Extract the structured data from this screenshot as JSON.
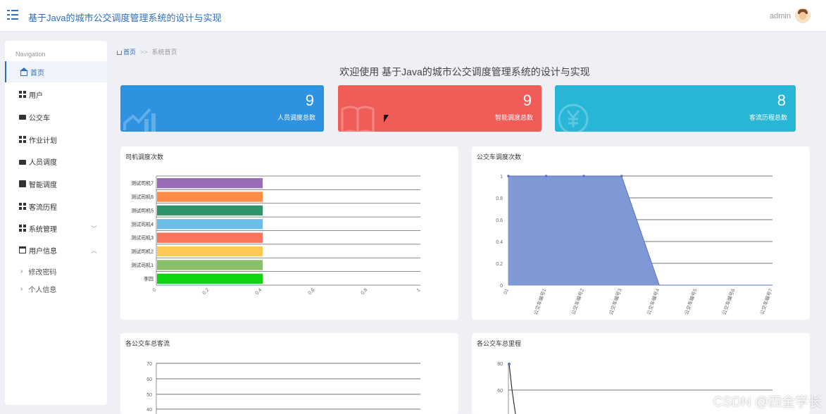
{
  "header": {
    "title": "基于Java的城市公交调度管理系统的设计与实现",
    "user": "admin"
  },
  "sidebar": {
    "heading": "Navigation",
    "items": [
      {
        "label": "首页",
        "icon": "home-icon"
      },
      {
        "label": "用户",
        "icon": "grid-icon"
      },
      {
        "label": "公交车",
        "icon": "chat-icon"
      },
      {
        "label": "作业计划",
        "icon": "grid-icon"
      },
      {
        "label": "人员调度",
        "icon": "briefcase-icon"
      },
      {
        "label": "智能调度",
        "icon": "clipboard-check-icon"
      },
      {
        "label": "客流历程",
        "icon": "grid-icon"
      },
      {
        "label": "系统管理",
        "icon": "grid-icon"
      },
      {
        "label": "用户信息",
        "icon": "window-icon"
      }
    ],
    "subitems": [
      {
        "label": "修改密码"
      },
      {
        "label": "个人信息"
      }
    ]
  },
  "breadcrumb": {
    "home": "首页",
    "sep": ">>",
    "current": "系统首页"
  },
  "welcome": "欢迎使用 基于Java的城市公交调度管理系统的设计与实现",
  "stats": [
    {
      "value": "9",
      "label": "人员调度总数",
      "color": "#2d92e0"
    },
    {
      "value": "9",
      "label": "智能调度总数",
      "color": "#f05d59"
    },
    {
      "value": "8",
      "label": "客流历程总数",
      "color": "#27b6d6"
    }
  ],
  "chart_data": [
    {
      "type": "bar",
      "orientation": "horizontal",
      "title": "司机调度次数",
      "categories": [
        "李四",
        "测试司机1",
        "测试司机2",
        "测试司机3",
        "测试司机4",
        "测试司机5",
        "测试司机6",
        "测试司机7"
      ],
      "values": [
        0.4,
        0.4,
        0.4,
        0.4,
        0.4,
        0.4,
        0.4,
        0.4
      ],
      "colors": [
        "#11d411",
        "#8bc06a",
        "#fdc853",
        "#fa735f",
        "#6cbde8",
        "#2e926a",
        "#fc8b45",
        "#9a6cb6"
      ],
      "xlim": [
        0,
        1
      ],
      "xticks": [
        "0",
        "0.2",
        "0.4",
        "0.6",
        "0.8",
        "1"
      ]
    },
    {
      "type": "area",
      "title": "公交车调度次数",
      "categories": [
        "01",
        "公交车编号1",
        "公交车编号2",
        "公交车编号3",
        "公交车编号4",
        "公交车编号5",
        "公交车编号6",
        "公交车编号7"
      ],
      "values": [
        1,
        1,
        1,
        1,
        0,
        0,
        0,
        0
      ],
      "ylim": [
        0,
        1
      ],
      "yticks": [
        "0",
        "0.2",
        "0.4",
        "0.6",
        "0.8",
        "1"
      ],
      "color": "#7f98d6"
    },
    {
      "type": "bar",
      "title": "各公交车总客流",
      "yticks_visible": [
        "40",
        "50",
        "60",
        "70"
      ]
    },
    {
      "type": "line",
      "title": "各公交车总里程",
      "yticks_visible": [
        "60",
        "80"
      ],
      "first_value": 80
    }
  ],
  "watermark": "CSDN @四金学长"
}
